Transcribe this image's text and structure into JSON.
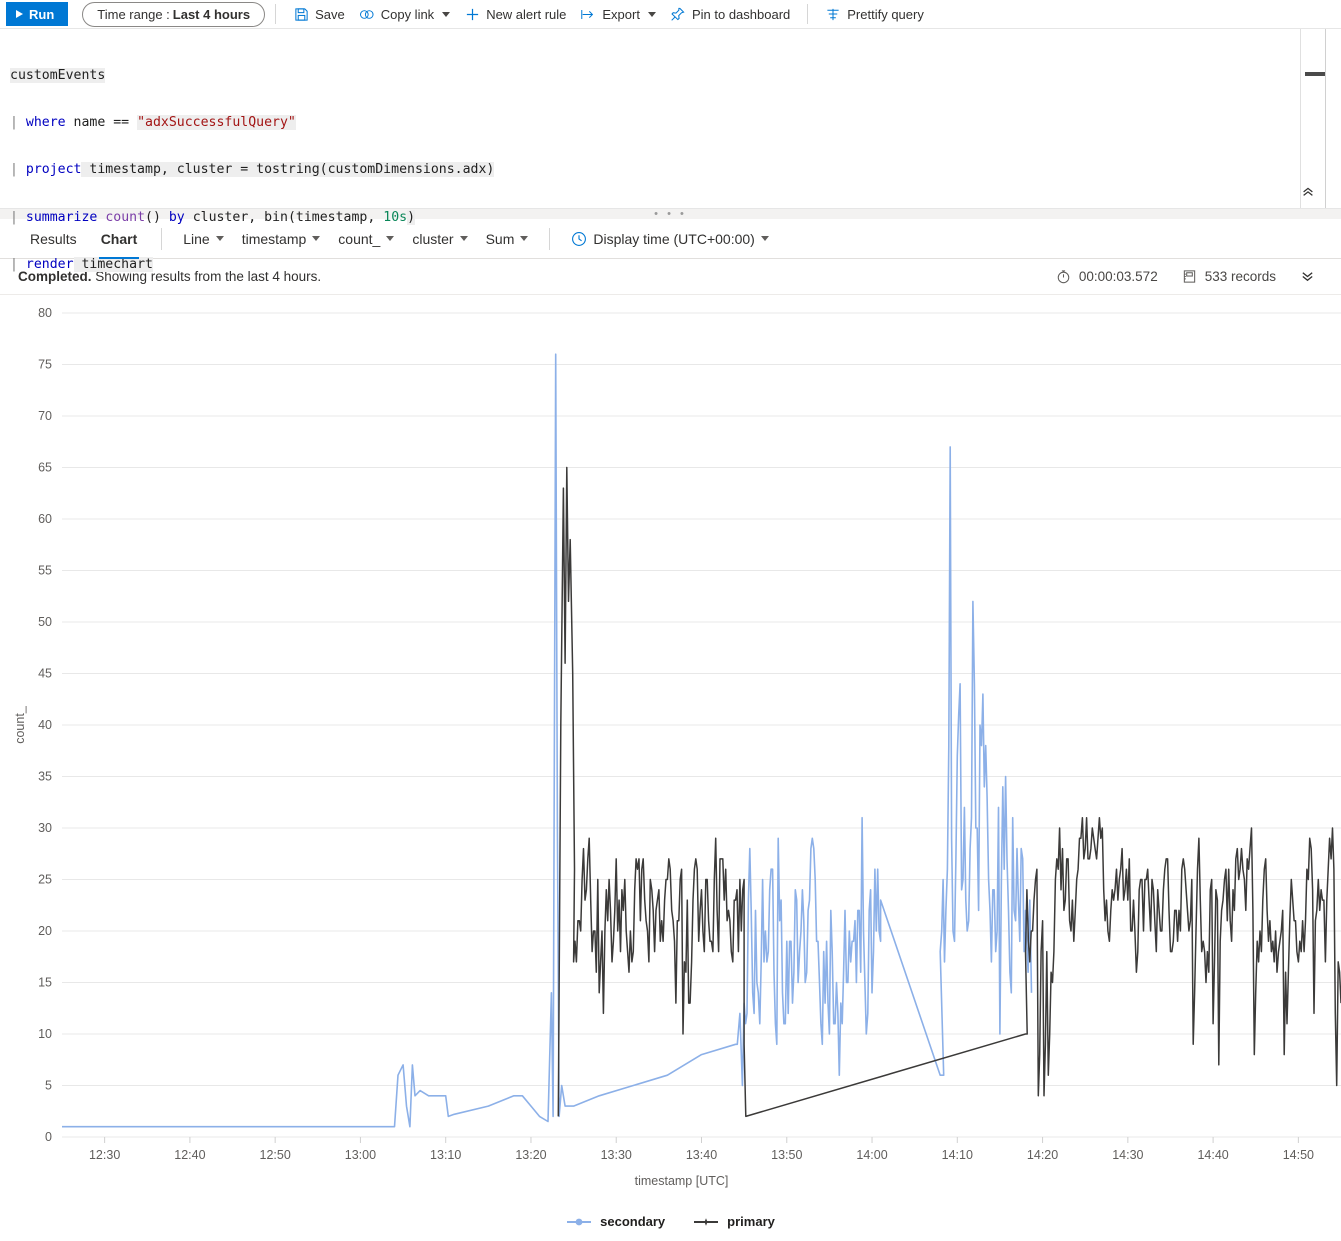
{
  "toolbar": {
    "run_label": "Run",
    "time_range_prefix": "Time range :",
    "time_range_value": "Last 4 hours",
    "save_label": "Save",
    "copy_link_label": "Copy link",
    "new_alert_rule_label": "New alert rule",
    "export_label": "Export",
    "pin_to_dashboard_label": "Pin to dashboard",
    "prettify_query_label": "Prettify query"
  },
  "editor": {
    "lines": [
      "customEvents",
      "| where name == \"adxSuccessfulQuery\"",
      "| project timestamp, cluster = tostring(customDimensions.adx)",
      "| summarize count() by cluster, bin(timestamp, 10s)",
      "| render timechart"
    ],
    "l1_table": "customEvents",
    "l2_kw": "where",
    "l2_mid": " name == ",
    "l2_str": "\"adxSuccessfulQuery\"",
    "l3_kw": "project",
    "l3_rest": " timestamp, cluster = tostring(customDimensions.adx)",
    "l4_kw": "summarize",
    "l4_fn": "count",
    "l4_mid": "() ",
    "l4_by": "by",
    "l4_rest": " cluster, bin(timestamp, ",
    "l4_num": "10s",
    "l4_end": ")",
    "l5_kw": "render",
    "l5_rest": " timechart",
    "pipe": "|",
    "drag_dots": "• • •"
  },
  "tabs": {
    "results_label": "Results",
    "chart_label": "Chart",
    "active": "Chart",
    "chart_type": "Line",
    "x_column": "timestamp",
    "y_column": "count_",
    "split_by": "cluster",
    "aggregation": "Sum",
    "display_time_label": "Display time (UTC+00:00)"
  },
  "status": {
    "state": "Completed.",
    "message": " Showing results from the last 4 hours.",
    "duration": "00:00:03.572",
    "records": "533 records"
  },
  "colors": {
    "accent": "#0078d4",
    "secondary_series": "#8cb0e8",
    "primary_series": "#3b3a39",
    "grid": "#e8e8e8",
    "axis_text": "#605e5c"
  },
  "chart_data": {
    "type": "line",
    "title": "",
    "xlabel": "timestamp [UTC]",
    "ylabel": "count_",
    "ylim": [
      0,
      80
    ],
    "yticks": [
      0,
      5,
      10,
      15,
      20,
      25,
      30,
      35,
      40,
      45,
      50,
      55,
      60,
      65,
      70,
      75,
      80
    ],
    "xticks": [
      "12:30",
      "12:40",
      "12:50",
      "13:00",
      "13:10",
      "13:20",
      "13:30",
      "13:40",
      "13:50",
      "14:00",
      "14:10",
      "14:20",
      "14:30",
      "14:40",
      "14:50"
    ],
    "x_start_min": 745,
    "x_end_min": 895,
    "x_tick_start_min": 750,
    "x_tick_step_min": 10,
    "grid": true,
    "legend_position": "bottom",
    "bin_seconds": 10,
    "series": [
      {
        "name": "secondary",
        "color": "#8cb0e8",
        "segments": [
          {
            "note": "flat baseline at 1 from 12:25 to 13:04",
            "mode": "flat",
            "t_start_min": 745,
            "t_end_min": 784,
            "value": 1
          },
          {
            "note": "small burst 13:04-13:10",
            "mode": "points",
            "points": [
              [
                784,
                1
              ],
              [
                784.4,
                6
              ],
              [
                785,
                7
              ],
              [
                785.4,
                3
              ],
              [
                785.8,
                1
              ],
              [
                786.1,
                7
              ],
              [
                786.4,
                4
              ],
              [
                787,
                4.5
              ],
              [
                788,
                4
              ],
              [
                789,
                4
              ],
              [
                790,
                4
              ],
              [
                790.3,
                2
              ],
              [
                791,
                2.2
              ]
            ]
          },
          {
            "note": "slow rise 13:11-13:18 then drop",
            "mode": "points",
            "points": [
              [
                791,
                2.2
              ],
              [
                795,
                3
              ],
              [
                798,
                4
              ],
              [
                799,
                4
              ],
              [
                800,
                3
              ],
              [
                801,
                2
              ],
              [
                802,
                1.5
              ]
            ]
          },
          {
            "note": "big spike at 13:22-13:23 peak 76",
            "mode": "points",
            "points": [
              [
                802,
                1.5
              ],
              [
                802.4,
                14
              ],
              [
                802.6,
                2
              ],
              [
                802.9,
                76
              ],
              [
                803.1,
                30
              ],
              [
                803.3,
                2
              ],
              [
                803.6,
                5
              ],
              [
                804,
                3
              ],
              [
                805,
                3
              ],
              [
                808,
                4
              ],
              [
                812,
                5
              ],
              [
                816,
                6
              ],
              [
                820,
                8
              ],
              [
                824,
                9
              ]
            ]
          },
          {
            "note": "gap / diagonal rise 13:23 to 13:40",
            "mode": "points",
            "points": [
              [
                824,
                9
              ],
              [
                824.2,
                9
              ],
              [
                824.5,
                12
              ],
              [
                824.8,
                5
              ]
            ]
          },
          {
            "note": "noisy band 13:40-14:01, range ~5-37",
            "mode": "noise",
            "t_start_min": 825,
            "t_end_min": 841,
            "base": 20,
            "amp": 9,
            "min": 5,
            "max": 37,
            "seed": 17
          },
          {
            "note": "diagonal drop 14:01-14:08 (data gap)",
            "mode": "points",
            "points": [
              [
                841,
                23
              ],
              [
                848,
                6
              ],
              [
                848.4,
                6
              ]
            ]
          },
          {
            "note": "tall spike block 14:08-14:18, peaks 67 and 52",
            "mode": "noise",
            "t_start_min": 848,
            "t_end_min": 858,
            "base": 28,
            "amp": 12,
            "min": 6,
            "max": 67,
            "seed": 41,
            "spikes": [
              [
                849.2,
                67
              ],
              [
                851.9,
                52
              ],
              [
                850.3,
                44
              ],
              [
                852.6,
                40
              ],
              [
                853.5,
                33
              ]
            ]
          },
          {
            "note": "tail drop to end of blue data at 14:18",
            "mode": "points",
            "points": [
              [
                858,
                22
              ],
              [
                858.3,
                16
              ],
              [
                858.5,
                23
              ],
              [
                858.7,
                14
              ]
            ]
          }
        ]
      },
      {
        "name": "primary",
        "color": "#3b3a39",
        "segments": [
          {
            "note": "spikes at 13:23, peak 65",
            "mode": "points",
            "points": [
              [
                803.2,
                2
              ],
              [
                803.5,
                40
              ],
              [
                803.8,
                63
              ],
              [
                804.0,
                46
              ],
              [
                804.2,
                65
              ],
              [
                804.4,
                52
              ],
              [
                804.6,
                58
              ],
              [
                804.9,
                45
              ],
              [
                805.1,
                26
              ]
            ]
          },
          {
            "note": "noisy band 13:25-13:40, range ~9-32",
            "mode": "noise",
            "t_start_min": 805,
            "t_end_min": 825,
            "base": 22,
            "amp": 6,
            "min": 9,
            "max": 32,
            "seed": 7
          },
          {
            "note": "diagonal gap fill 13:40-14:18 rising 2 to 10",
            "mode": "points",
            "points": [
              [
                825,
                9
              ],
              [
                825.2,
                2
              ],
              [
                858,
                10
              ],
              [
                858.2,
                10
              ]
            ]
          },
          {
            "note": "main noisy band 14:18-14:55, range ~3-32",
            "mode": "noise",
            "t_start_min": 858,
            "t_end_min": 895,
            "base": 23,
            "amp": 6,
            "min": 3,
            "max": 32,
            "seed": 97
          }
        ]
      }
    ]
  }
}
